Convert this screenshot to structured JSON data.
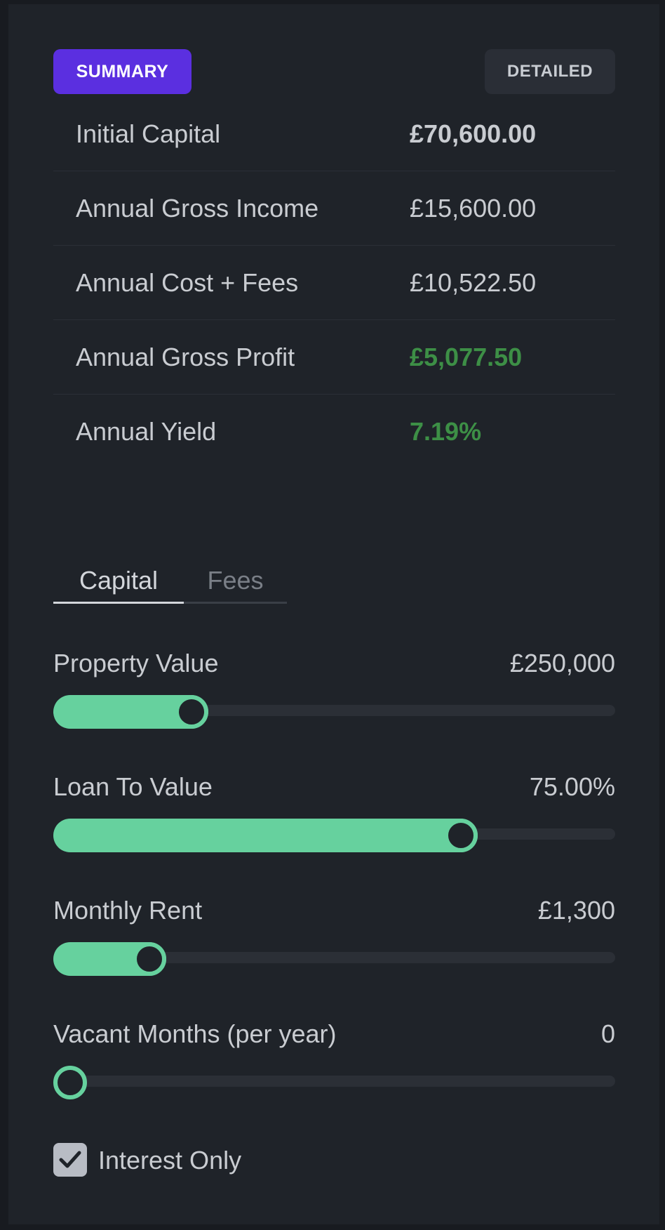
{
  "view_toggle": {
    "summary_label": "SUMMARY",
    "detailed_label": "DETAILED",
    "active": "summary"
  },
  "summary": {
    "rows": [
      {
        "label": "Initial Capital",
        "value": "£70,600.00"
      },
      {
        "label": "Annual Gross Income",
        "value": "£15,600.00"
      },
      {
        "label": "Annual Cost + Fees",
        "value": "£10,522.50"
      },
      {
        "label": "Annual Gross Profit",
        "value": "£5,077.50"
      },
      {
        "label": "Annual Yield",
        "value": "7.19%"
      }
    ]
  },
  "tabs": [
    {
      "label": "Capital",
      "active": true
    },
    {
      "label": "Fees",
      "active": false
    }
  ],
  "sliders": [
    {
      "label": "Property Value",
      "value": "£250,000",
      "fill_fraction": 0.23
    },
    {
      "label": "Loan To Value",
      "value": "75.00%",
      "fill_fraction": 0.74
    },
    {
      "label": "Monthly Rent",
      "value": "£1,300",
      "fill_fraction": 0.15
    },
    {
      "label": "Vacant Months (per year)",
      "value": "0",
      "fill_fraction": 0.0
    }
  ],
  "interest_only": {
    "label": "Interest Only",
    "checked": true
  },
  "colors": {
    "accent": "#5b2fe0",
    "slider": "#66d19e",
    "positive": "#3d8f46",
    "background": "#1f2329"
  }
}
